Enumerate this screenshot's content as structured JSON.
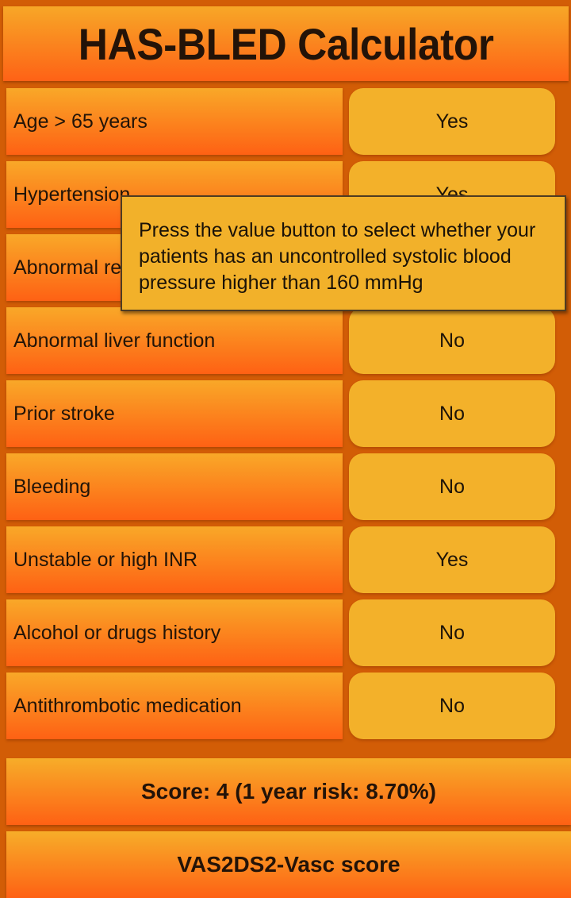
{
  "header": {
    "title": "HAS-BLED Calculator"
  },
  "criteria": [
    {
      "label": "Age > 65 years",
      "value": "Yes"
    },
    {
      "label": "Hypertension",
      "value": "Yes"
    },
    {
      "label": "Abnormal renal function",
      "value": ""
    },
    {
      "label": "Abnormal liver function",
      "value": "No"
    },
    {
      "label": "Prior stroke",
      "value": "No"
    },
    {
      "label": "Bleeding",
      "value": "No"
    },
    {
      "label": "Unstable or high INR",
      "value": "Yes"
    },
    {
      "label": "Alcohol or drugs history",
      "value": "No"
    },
    {
      "label": "Antithrombotic medication",
      "value": "No"
    }
  ],
  "result": {
    "score_text": "Score: 4 (1 year risk: 8.70%)"
  },
  "footer": {
    "link_label": "VAS2DS2-Vasc score"
  },
  "tooltip": {
    "text": "Press the value button to select whether your patients has an uncontrolled systolic blood pressure higher than 160 mmHg"
  },
  "colors": {
    "background": "#d25d06",
    "label_gradient_top": "#f9a828",
    "label_gradient_bottom": "#fe6114",
    "value_button": "#f3b12a",
    "text": "#221408"
  }
}
